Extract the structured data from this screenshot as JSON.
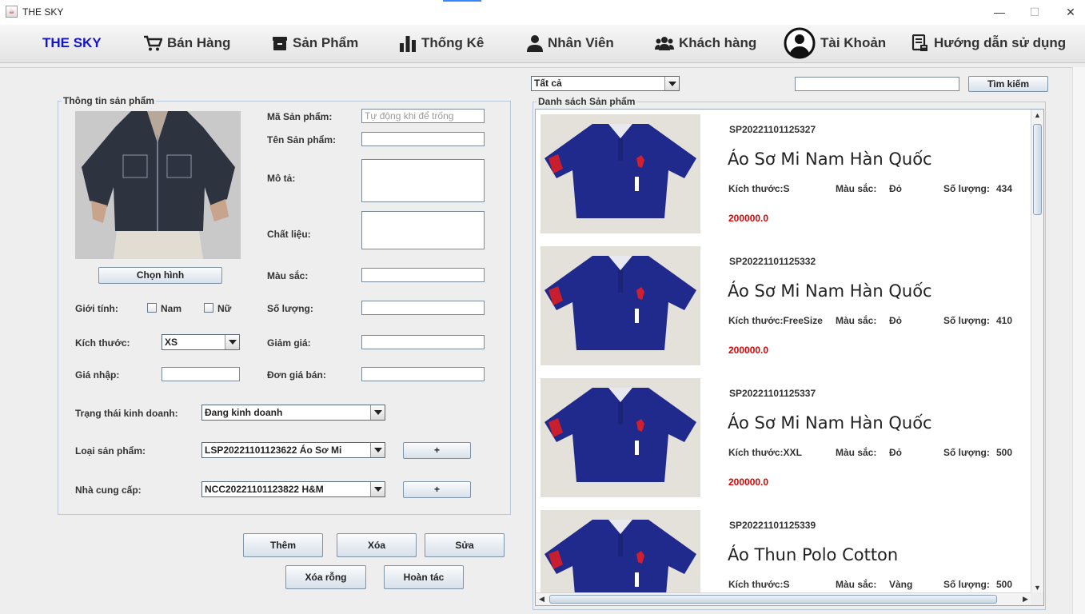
{
  "window": {
    "title": "THE SKY",
    "minimize": "—",
    "maximize": "☐",
    "close": "✕"
  },
  "menu": {
    "brand": "THE SKY",
    "items": [
      {
        "label": "Bán Hàng",
        "icon": "cart-icon"
      },
      {
        "label": "Sản Phẩm",
        "icon": "box-icon"
      },
      {
        "label": "Thống Kê",
        "icon": "bar-chart-icon"
      },
      {
        "label": "Nhân Viên",
        "icon": "user-icon"
      },
      {
        "label": "Khách hàng",
        "icon": "users-icon"
      },
      {
        "label": "Tài Khoản",
        "icon": "account-circle-icon"
      },
      {
        "label": "Hướng dẫn sử dụng",
        "icon": "manual-icon"
      }
    ]
  },
  "form": {
    "group_title": "Thông tin sản phẩm",
    "choose_image": "Chọn hình",
    "product_id_label": "Mã Sản phẩm:",
    "product_id_placeholder": "Tự động khi để trống",
    "name_label": "Tên Sản phẩm:",
    "desc_label": "Mô tả:",
    "material_label": "Chất liệu:",
    "color_label": "Màu sắc:",
    "gender_label": "Giới tính:",
    "gender_male": "Nam",
    "gender_female": "Nữ",
    "quantity_label": "Số lượng:",
    "size_label": "Kích thước:",
    "size_value": "XS",
    "discount_label": "Giảm giá:",
    "import_price_label": "Giá nhập:",
    "sell_price_label": "Đơn giá bán:",
    "status_label": "Trạng thái kinh doanh:",
    "status_value": "Đang kinh doanh",
    "category_label": "Loại sản phẩm:",
    "category_value": "LSP20221101123622 Áo Sơ Mi",
    "supplier_label": "Nhà cung cấp:",
    "supplier_value": "NCC20221101123822 H&M",
    "plus": "+"
  },
  "actions": {
    "add": "Thêm",
    "delete": "Xóa",
    "edit": "Sửa",
    "clear": "Xóa rỗng",
    "undo": "Hoàn tác"
  },
  "search": {
    "filter_value": "Tất cả",
    "query": "",
    "button": "Tìm kiếm"
  },
  "list": {
    "title": "Danh sách Sản phẩm",
    "size_label": "Kích thước:",
    "color_label": "Màu sắc:",
    "qty_label": "Số lượng:",
    "products": [
      {
        "id": "SP20221101125327",
        "name": "Áo Sơ Mi Nam Hàn Quốc",
        "size": "S",
        "color": "Đỏ",
        "qty": "434",
        "price": "200000.0"
      },
      {
        "id": "SP20221101125332",
        "name": "Áo Sơ Mi Nam Hàn Quốc",
        "size": "FreeSize",
        "color": "Đỏ",
        "qty": "410",
        "price": "200000.0"
      },
      {
        "id": "SP20221101125337",
        "name": "Áo Sơ Mi Nam Hàn Quốc",
        "size": "XXL",
        "color": "Đỏ",
        "qty": "500",
        "price": "200000.0"
      },
      {
        "id": "SP20221101125339",
        "name": "Áo Thun Polo Cotton",
        "size": "S",
        "color": "Vàng",
        "qty": "500",
        "price": ""
      }
    ]
  },
  "colors": {
    "brand": "#1414cc",
    "price": "#dd0000",
    "shirt": "#1f2a8c"
  }
}
